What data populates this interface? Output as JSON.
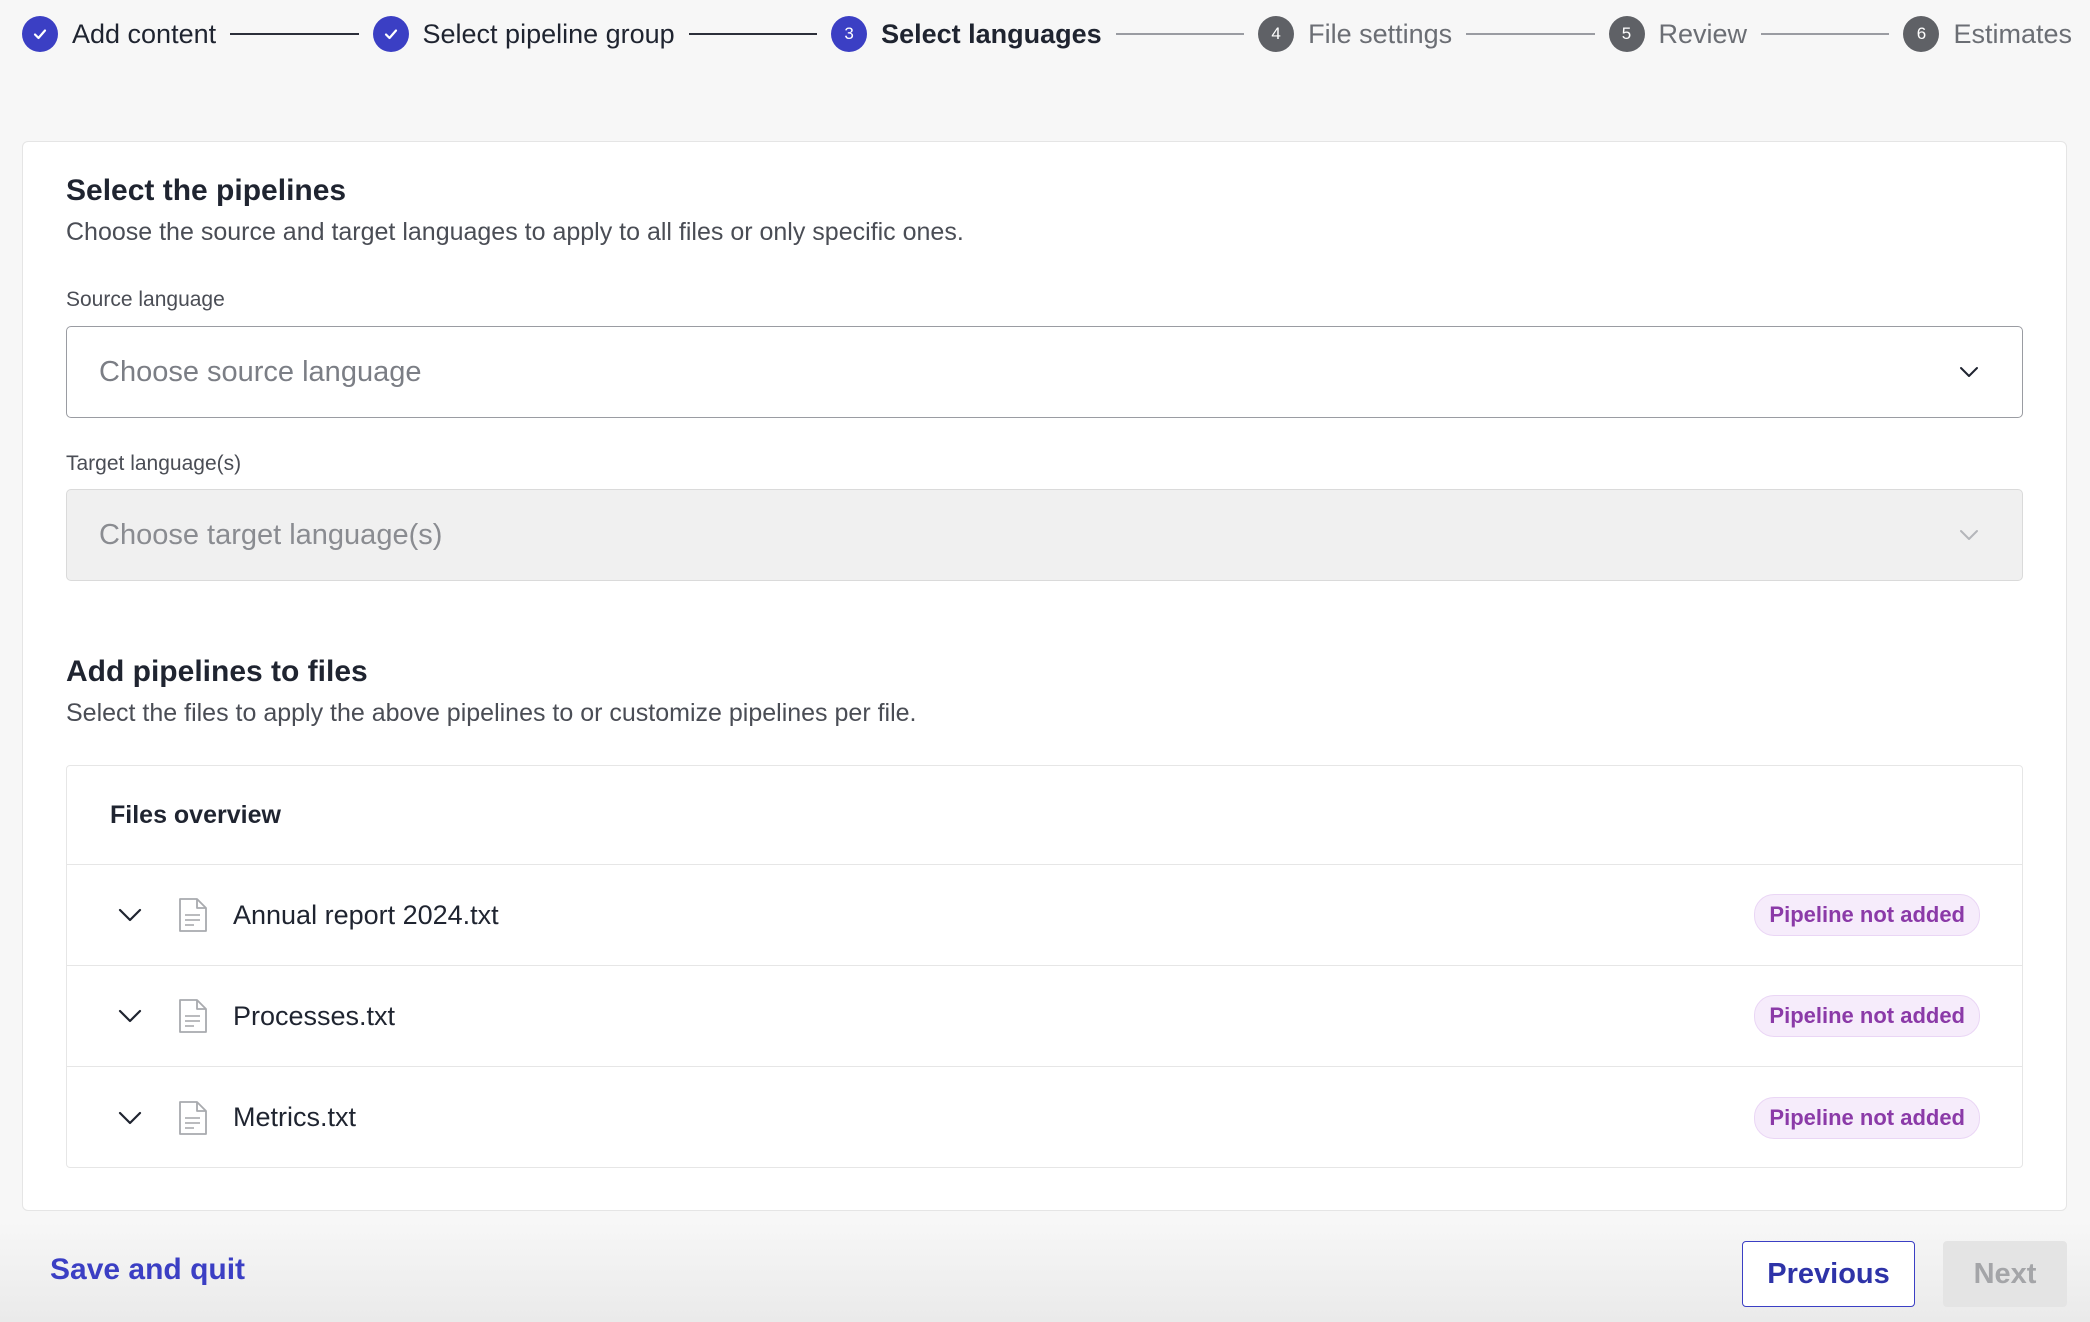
{
  "stepper": {
    "steps": [
      {
        "number": "1",
        "label": "Add content",
        "state": "done"
      },
      {
        "number": "2",
        "label": "Select pipeline group",
        "state": "done"
      },
      {
        "number": "3",
        "label": "Select languages",
        "state": "active"
      },
      {
        "number": "4",
        "label": "File settings",
        "state": "todo"
      },
      {
        "number": "5",
        "label": "Review",
        "state": "todo"
      },
      {
        "number": "6",
        "label": "Estimates",
        "state": "todo"
      }
    ]
  },
  "pipelines": {
    "title": "Select the pipelines",
    "description": "Choose the source and target languages to apply to all files or only specific ones.",
    "source_label": "Source language",
    "source_placeholder": "Choose source language",
    "target_label": "Target language(s)",
    "target_placeholder": "Choose target language(s)"
  },
  "add_pipelines": {
    "title": "Add pipelines to files",
    "description": "Select the files to apply the above pipelines to or customize pipelines per file.",
    "files_header": "Files overview",
    "files": [
      {
        "name": "Annual report 2024.txt",
        "status": "Pipeline not added"
      },
      {
        "name": "Processes.txt",
        "status": "Pipeline not added"
      },
      {
        "name": "Metrics.txt",
        "status": "Pipeline not added"
      }
    ]
  },
  "footer": {
    "save_quit": "Save and quit",
    "previous": "Previous",
    "next": "Next"
  },
  "colors": {
    "accent": "#3b3fc4",
    "badge_text": "#8b3aa8",
    "badge_bg": "#f6ecfb"
  }
}
